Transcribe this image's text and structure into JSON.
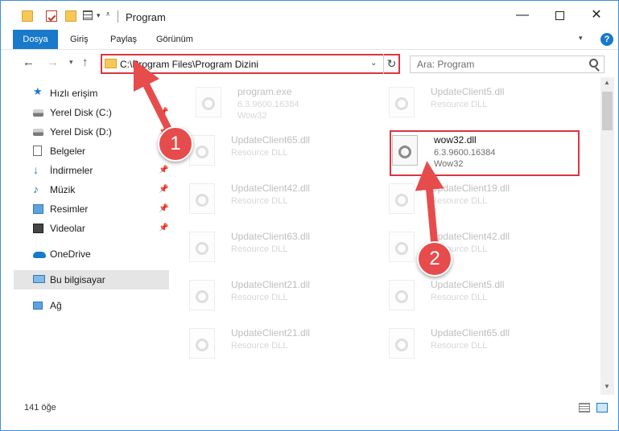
{
  "window": {
    "title": "Program"
  },
  "title_controls": {
    "minimize": "—",
    "maximize": "",
    "close": "✕"
  },
  "ribbon": {
    "tabs": [
      {
        "label": "Dosya"
      },
      {
        "label": "Giriş"
      },
      {
        "label": "Paylaş"
      },
      {
        "label": "Görünüm"
      }
    ],
    "help": "?"
  },
  "nav": {
    "back": "←",
    "forward": "→",
    "up": "↑",
    "address": "C:\\Program Files\\Program Dizini",
    "refresh": "↻"
  },
  "search": {
    "placeholder": "Ara: Program"
  },
  "sidebar": {
    "items": [
      {
        "label": "Hızlı erişim"
      },
      {
        "label": "Yerel Disk (C:)"
      },
      {
        "label": "Yerel Disk (D:)"
      },
      {
        "label": "Belgeler"
      },
      {
        "label": "İndirmeler"
      },
      {
        "label": "Müzik"
      },
      {
        "label": "Resimler"
      },
      {
        "label": "Videolar"
      },
      {
        "label": "OneDrive"
      },
      {
        "label": "Bu bilgisayar"
      },
      {
        "label": "Ağ"
      }
    ]
  },
  "files": [
    {
      "name": "program.exe",
      "line1": "6.3.9600.16384",
      "line2": "Wow32"
    },
    {
      "name": "UpdateClient5.dll",
      "line1": "Resource DLL",
      "line2": ""
    },
    {
      "name": "UpdateClient65.dll",
      "line1": "Resource DLL",
      "line2": ""
    },
    {
      "name": "wow32.dll",
      "line1": "6.3.9600.16384",
      "line2": "Wow32"
    },
    {
      "name": "UpdateClient42.dll",
      "line1": "Resource DLL",
      "line2": ""
    },
    {
      "name": "UpdateClient19.dll",
      "line1": "Resource DLL",
      "line2": ""
    },
    {
      "name": "UpdateClient63.dll",
      "line1": "Resource DLL",
      "line2": ""
    },
    {
      "name": "UpdateClient42.dll",
      "line1": "Resource DLL",
      "line2": ""
    },
    {
      "name": "UpdateClient21.dll",
      "line1": "Resource DLL",
      "line2": ""
    },
    {
      "name": "UpdateClient5.dll",
      "line1": "Resource DLL",
      "line2": ""
    },
    {
      "name": "UpdateClient21.dll",
      "line1": "Resource DLL",
      "line2": ""
    },
    {
      "name": "UpdateClient65.dll",
      "line1": "Resource DLL",
      "line2": ""
    }
  ],
  "status": {
    "count": "141 öğe"
  },
  "annotations": {
    "step1": "1",
    "step2": "2"
  },
  "colors": {
    "accent": "#1979ca",
    "annotation": "#d9363e",
    "badge": "#e74c4c"
  }
}
